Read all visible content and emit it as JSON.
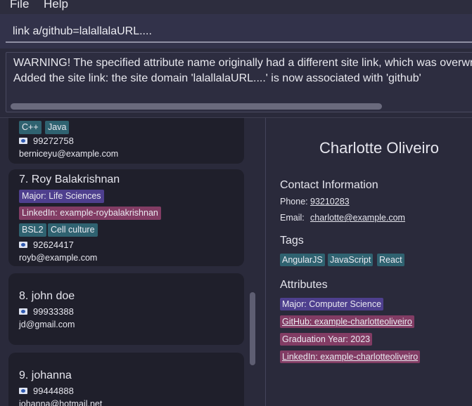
{
  "menu": {
    "file": "File",
    "help": "Help"
  },
  "command": {
    "value": "link a/github=lalallalaURL...."
  },
  "result": {
    "line1": "WARNING! The specified attribute name originally had a different site link, which was overwritten.",
    "line2": "Added the site link: the site domain 'lalallalaURL....' is now associated with 'github'"
  },
  "list": {
    "card6": {
      "tags": [
        "C++",
        "Java"
      ],
      "phone": "99272758",
      "email": "berniceyu@example.com"
    },
    "card7": {
      "name": "7. Roy Balakrishnan",
      "major": "Major: Life Sciences",
      "linkedin": "LinkedIn: example-roybalakrishnan",
      "tags": [
        "BSL2",
        "Cell culture"
      ],
      "phone": "92624417",
      "email": "royb@example.com"
    },
    "card8": {
      "name": "8. john doe",
      "phone": "99933388",
      "email": "jd@gmail.com"
    },
    "card9": {
      "name": "9. johanna",
      "phone": "99444888",
      "email": "johanna@hotmail.net"
    }
  },
  "detail": {
    "name": "Charlotte Oliveiro",
    "contact_title": "Contact Information",
    "phone_label": "Phone:",
    "phone": "93210283",
    "email_label": "Email:",
    "email": "charlotte@example.com",
    "tags_title": "Tags",
    "tags": [
      "AngularJS",
      "JavaScript",
      "React"
    ],
    "attributes_title": "Attributes",
    "attributes": [
      "Major: Computer Science",
      "GitHub: example-charlotteoliveiro",
      "Graduation Year: 2023",
      "LinkedIn: example-charlotteoliveiro"
    ]
  },
  "colors": {
    "purple": "#4e3f8e",
    "pink": "#823c64",
    "teal": "#2f6270"
  }
}
